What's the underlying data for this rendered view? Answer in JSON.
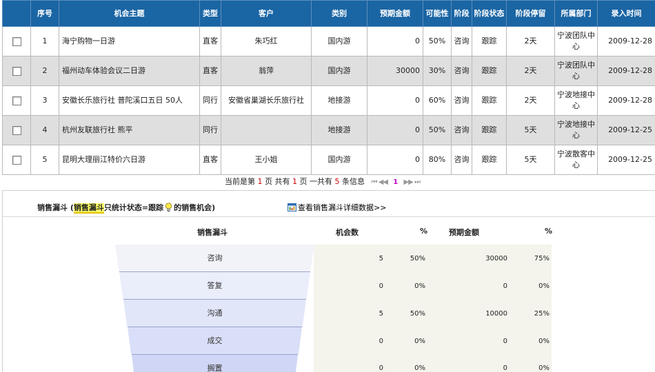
{
  "table": {
    "headers": {
      "seq": "序号",
      "topic": "机会主题",
      "type": "类型",
      "customer": "客户",
      "category": "类别",
      "amount": "预期金额",
      "probability": "可能性",
      "stage": "阶段",
      "stage_status": "阶段状态",
      "stage_stay": "阶段停留",
      "department": "所属部门",
      "entry_time": "录入时间"
    },
    "rows": [
      {
        "seq": "1",
        "topic": "海宁购物一日游",
        "type": "直客",
        "customer": "朱巧红",
        "category": "国内游",
        "amount": "0",
        "probability": "50%",
        "stage": "咨询",
        "stage_status": "跟踪",
        "stage_stay": "2天",
        "department": "宁波团队中心",
        "entry_time": "2009-12-28"
      },
      {
        "seq": "2",
        "topic": "福州动车体验会议二日游",
        "type": "直客",
        "customer": "翁萍",
        "category": "国内游",
        "amount": "30000",
        "probability": "30%",
        "stage": "咨询",
        "stage_status": "跟踪",
        "stage_stay": "2天",
        "department": "宁波团队中心",
        "entry_time": "2009-12-28"
      },
      {
        "seq": "3",
        "topic": "安徽长乐旅行社 普陀溪口五日 50人",
        "type": "同行",
        "customer": "安徽省巢湖长乐旅行社",
        "category": "地接游",
        "amount": "0",
        "probability": "60%",
        "stage": "咨询",
        "stage_status": "跟踪",
        "stage_stay": "2天",
        "department": "宁波地接中心",
        "entry_time": "2009-12-28"
      },
      {
        "seq": "4",
        "topic": "杭州友联旅行社 熊平",
        "type": "同行",
        "customer": "",
        "category": "地接游",
        "amount": "0",
        "probability": "50%",
        "stage": "咨询",
        "stage_status": "跟踪",
        "stage_stay": "5天",
        "department": "宁波地接中心",
        "entry_time": "2009-12-25"
      },
      {
        "seq": "5",
        "topic": "昆明大理丽江特价六日游",
        "type": "直客",
        "customer": "王小姐",
        "category": "国内游",
        "amount": "0",
        "probability": "80%",
        "stage": "咨询",
        "stage_status": "跟踪",
        "stage_stay": "5天",
        "department": "宁波散客中心",
        "entry_time": "2009-12-25"
      }
    ]
  },
  "pager": {
    "t1": "当前是第",
    "current_page": "1",
    "t2": "页 共有",
    "total_pages": "1",
    "t3": "页 一共有",
    "total_records": "5",
    "t4": "条信息",
    "first": "⏮",
    "prev": "◀◀",
    "page_link": "1",
    "next": "▶▶",
    "last": "⏭"
  },
  "funnel_panel": {
    "title_prefix": "销售漏斗 (",
    "title_highlight": "销售漏斗",
    "title_middle": "只统计状态=跟踪",
    "title_suffix": "的销售机会)",
    "detail_link": "查看销售漏斗详细数据>>",
    "columns": {
      "funnel": "销售漏斗",
      "count": "机会数",
      "count_pct": "%",
      "amount": "预期金额",
      "amount_pct": "%"
    },
    "stages": [
      {
        "name": "咨询",
        "count": "5",
        "count_pct": "50%",
        "amount": "30000",
        "amount_pct": "75%"
      },
      {
        "name": "答复",
        "count": "0",
        "count_pct": "0%",
        "amount": "0",
        "amount_pct": "0%"
      },
      {
        "name": "沟通",
        "count": "5",
        "count_pct": "50%",
        "amount": "10000",
        "amount_pct": "25%"
      },
      {
        "name": "成交",
        "count": "0",
        "count_pct": "0%",
        "amount": "0",
        "amount_pct": "0%"
      },
      {
        "name": "搁置",
        "count": "0",
        "count_pct": "0%",
        "amount": "0",
        "amount_pct": "0%"
      }
    ]
  },
  "colors": {
    "header_bg": "#1a65a4",
    "row_alt_bg": "#dfdfdf",
    "funnel_top": "#f2f2f8",
    "funnel_bottom": "#cfd6f6",
    "stats_bg": "#f4f4ec",
    "highlight": "#ffff66"
  },
  "icons": {
    "checkbox": "checkbox-icon",
    "bulb": "lightbulb-icon",
    "report": "report-icon"
  }
}
